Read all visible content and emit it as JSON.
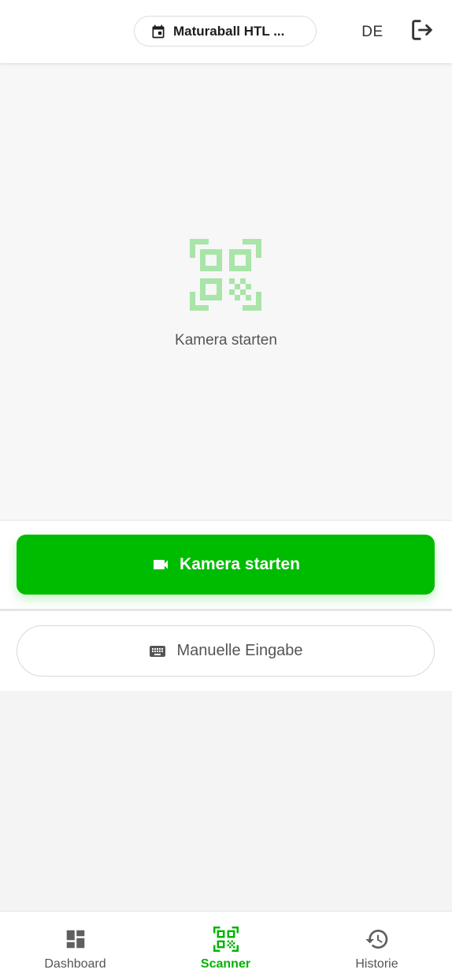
{
  "header": {
    "event_name": "Maturaball HTL ...",
    "language": "DE"
  },
  "camera": {
    "hint": "Kamera starten"
  },
  "actions": {
    "start_camera_label": "Kamera starten",
    "manual_entry_label": "Manuelle Eingabe"
  },
  "nav": {
    "items": [
      {
        "label": "Dashboard",
        "icon": "dashboard-icon",
        "active": false
      },
      {
        "label": "Scanner",
        "icon": "qr-scanner-icon",
        "active": true
      },
      {
        "label": "Historie",
        "icon": "history-icon",
        "active": false
      }
    ]
  },
  "colors": {
    "accent": "#00bc00",
    "accent_light": "#a9e4a9",
    "text_muted": "#555555"
  }
}
